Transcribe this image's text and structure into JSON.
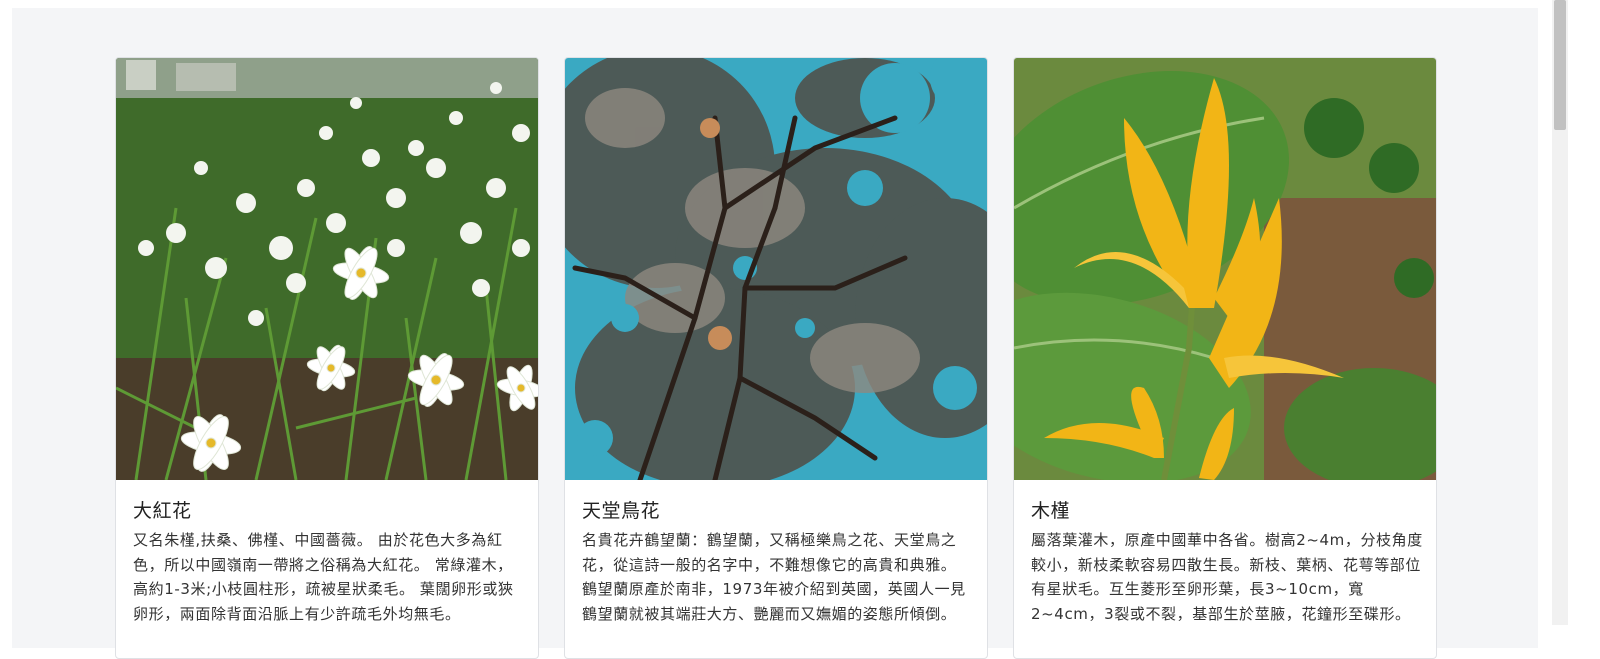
{
  "cards": [
    {
      "title": "大紅花",
      "description": "又名朱槿,扶桑、佛槿、中國薔薇。 由於花色大多為紅色，所以中國嶺南一帶將之俗稱為大紅花。 常綠灌木，高約1-3米;小枝圓柱形，疏被星狀柔毛。 葉闊卵形或狹卵形，兩面除背面沿脈上有少許疏毛外均無毛。",
      "image_icon": "white-rain-lily-flowers-photo"
    },
    {
      "title": "天堂鳥花",
      "description": "名貴花卉鶴望蘭：鶴望蘭，又稱極樂鳥之花、天堂鳥之花，從這詩一般的名字中，不難想像它的高貴和典雅。 鶴望蘭原產於南非，1973年被介紹到英國，英國人一見鶴望蘭就被其端莊大方、艷麗而又嫵媚的姿態所傾倒。",
      "image_icon": "pine-tree-branches-sky-photo"
    },
    {
      "title": "木槿",
      "description": "屬落葉灌木，原產中國華中各省。樹高2~4m，分枝角度較小，新枝柔軟容易四散生長。新枝、葉柄、花萼等部位有星狀毛。互生菱形至卵形葉，長3~10cm，寬2~4cm，3裂或不裂，基部生於莖腋，花鐘形至碟形。",
      "image_icon": "yellow-canna-flower-photo"
    }
  ]
}
